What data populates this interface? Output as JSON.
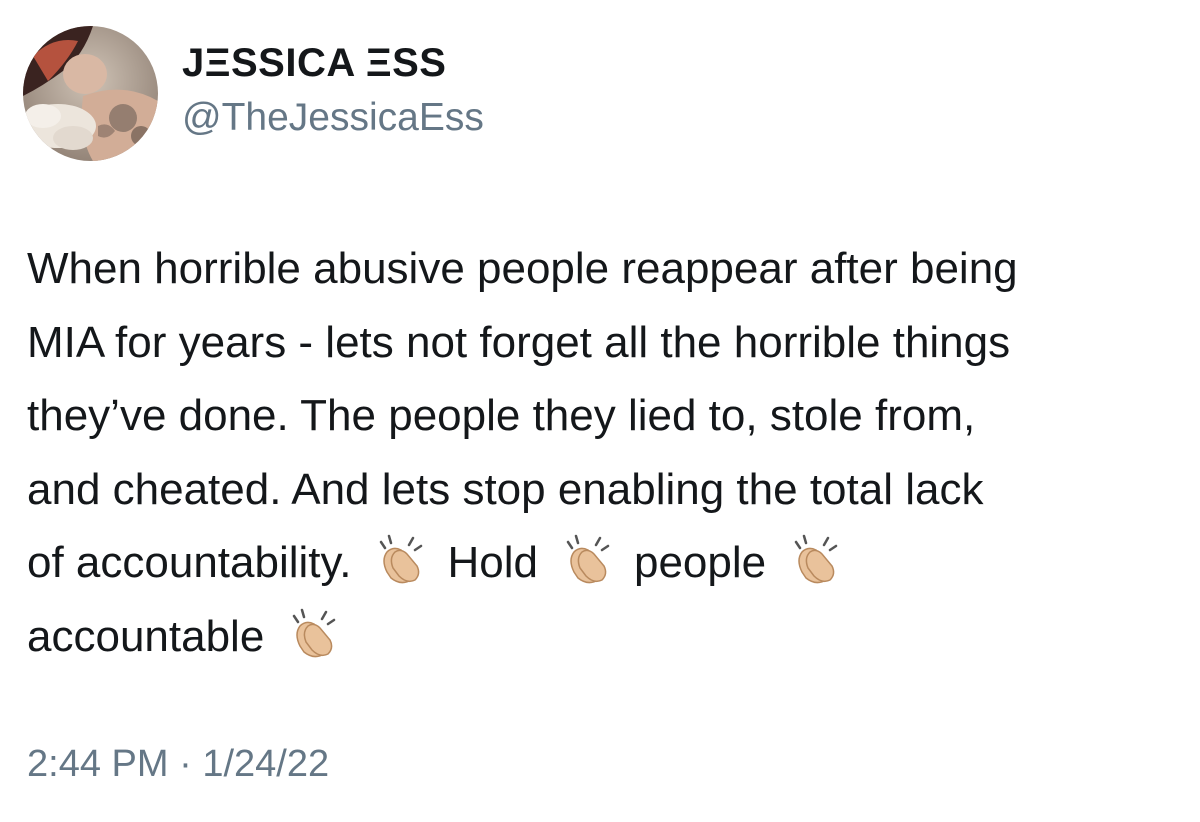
{
  "author": {
    "display_name": "JΞSSICA ΞSS",
    "handle": "@TheJessicaEss",
    "avatar_icon": "profile-photo"
  },
  "tweet": {
    "lines": [
      "When horrible abusive people reappear after being",
      "MIA for years - lets not forget all the horrible things",
      "they’ve done. The people they lied to, stole from,",
      "and cheated. And lets stop enabling the total lack"
    ],
    "line5_part1": "of accountability.",
    "line5_part2": "Hold",
    "line5_part3": "people",
    "line6_part1": "accountable",
    "emoji_icon": "clapping-hands-icon"
  },
  "meta": {
    "time": "2:44 PM",
    "separator": "·",
    "date": "1/24/22"
  },
  "colors": {
    "text": "#14171a",
    "secondary": "#657786",
    "background": "#ffffff"
  }
}
